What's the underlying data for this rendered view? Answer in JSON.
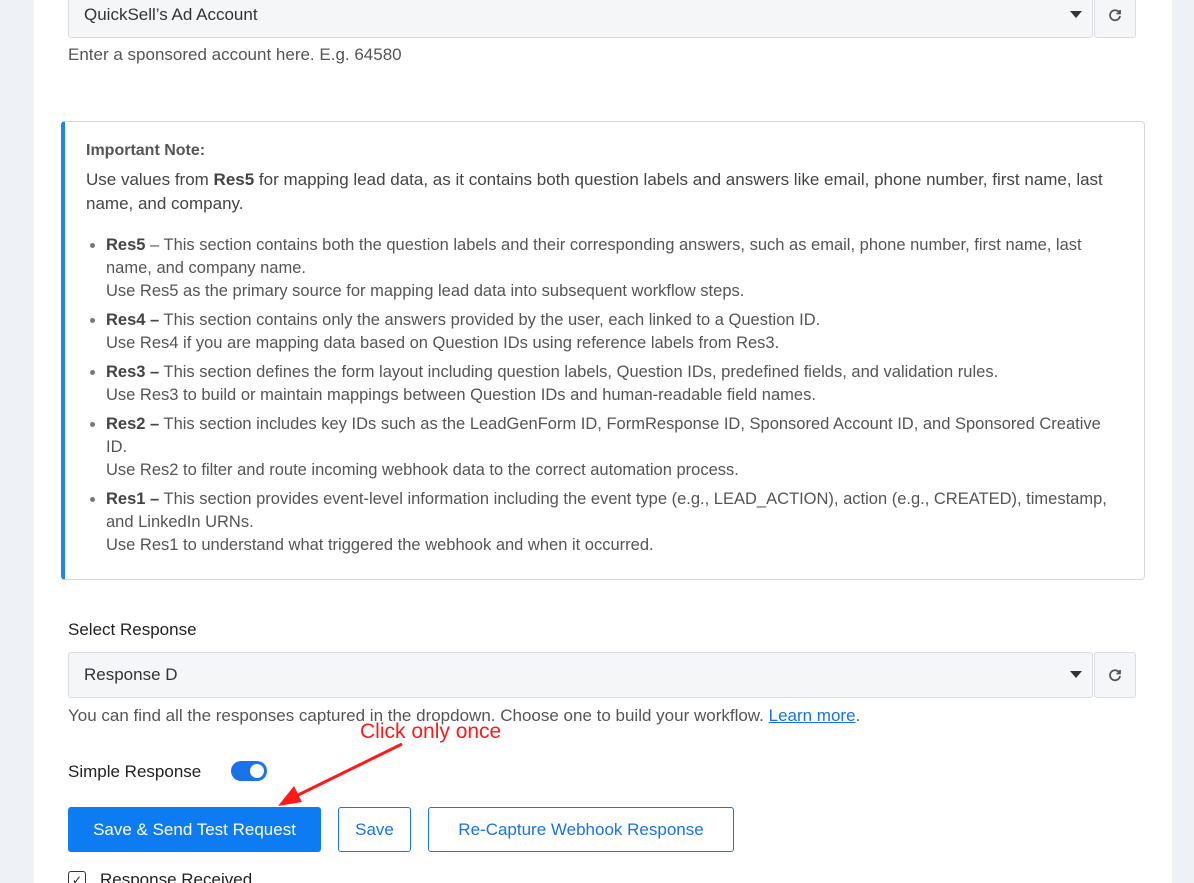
{
  "account": {
    "selected": "QuickSell’s Ad Account",
    "helper": "Enter a sponsored account here. E.g. 64580"
  },
  "note": {
    "title": "Important Note:",
    "intro_pre": "Use values from ",
    "intro_bold": "Res5",
    "intro_post": " for mapping lead data, as it contains both question labels and answers like email, phone number, first name, last name, and company.",
    "items": [
      {
        "key": "Res5",
        "sep": " – ",
        "line1": "This section contains both the question labels and their corresponding answers, such as email, phone number, first name, last name, and company name.",
        "line2": "Use Res5 as the primary source for mapping lead data into subsequent workflow steps."
      },
      {
        "key": "Res4 –",
        "sep": " ",
        "line1": "This section contains only the answers provided by the user, each linked to a Question ID.",
        "line2": "Use Res4 if you are mapping data based on Question IDs using reference labels from Res3."
      },
      {
        "key": "Res3 –",
        "sep": " ",
        "line1": "This section defines the form layout including question labels, Question IDs, predefined fields, and validation rules.",
        "line2": "Use Res3 to build or maintain mappings between Question IDs and human-readable field names."
      },
      {
        "key": "Res2 –",
        "sep": " ",
        "line1": "This section includes key IDs such as the LeadGenForm ID, FormResponse ID, Sponsored Account ID, and Sponsored Creative ID.",
        "line2": "Use Res2 to filter and route incoming webhook data to the correct automation process."
      },
      {
        "key": "Res1 –",
        "sep": "  ",
        "line1": "This section provides event-level information including the event type (e.g., LEAD_ACTION), action (e.g., CREATED), timestamp, and LinkedIn URNs.",
        "line2": "Use Res1 to understand what triggered the webhook and when it occurred."
      }
    ]
  },
  "response": {
    "label": "Select Response",
    "selected": "Response D",
    "helper": "You can find all the responses captured in the dropdown. Choose one to build your workflow.",
    "learn_more": "Learn more",
    "helper_end": "."
  },
  "simple_response": {
    "label": "Simple Response",
    "enabled": true
  },
  "buttons": {
    "save_send": "Save & Send Test Request",
    "save": "Save",
    "recapture": "Re-Capture Webhook Response"
  },
  "annotation": {
    "text": "Click only once",
    "color": "#ff1a1a"
  },
  "response_received": {
    "label": "Response Received"
  },
  "colors": {
    "accent": "#1a73e8",
    "note_border": "#1e88e5"
  }
}
